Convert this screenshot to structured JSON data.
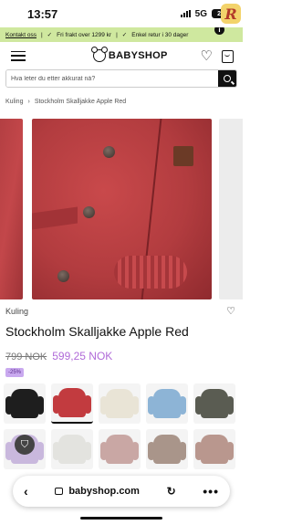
{
  "status_bar": {
    "time": "13:57",
    "network": "5G",
    "battery": "23"
  },
  "promo": {
    "items": [
      "Kontakt oss",
      "Fri frakt over 1299 kr",
      "Enkel retur i 30 dager"
    ],
    "separator": "|",
    "check": "✓"
  },
  "header": {
    "brand": "BABYSHOP"
  },
  "search": {
    "placeholder": "Hva leter du etter akkurat nå?"
  },
  "breadcrumb": {
    "items": [
      "Kuling",
      "Stockholm Skalljakke Apple Red"
    ],
    "separator": "›"
  },
  "product": {
    "brand": "Kuling",
    "title": "Stockholm Skalljakke Apple Red",
    "price_old": "799 NOK",
    "price_new": "599,25 NOK",
    "discount": "-25%"
  },
  "variants": [
    {
      "color": "#1e1e1e"
    },
    {
      "color": "#c23b3f",
      "selected": true
    },
    {
      "color": "#e9e4d6"
    },
    {
      "color": "#8db4d6"
    },
    {
      "color": "#5a5c52"
    },
    {
      "color": "#c9b8dd",
      "locked": true
    },
    {
      "color": "#e3e3df"
    },
    {
      "color": "#c9a7a4"
    },
    {
      "color": "#a9958a"
    },
    {
      "color": "#b9978e"
    }
  ],
  "browser": {
    "url": "babyshop.com"
  },
  "colors": {
    "promo_bg": "#cfe89f",
    "price_sale": "#b06ad8",
    "badge_bg": "#c9a9ef"
  }
}
